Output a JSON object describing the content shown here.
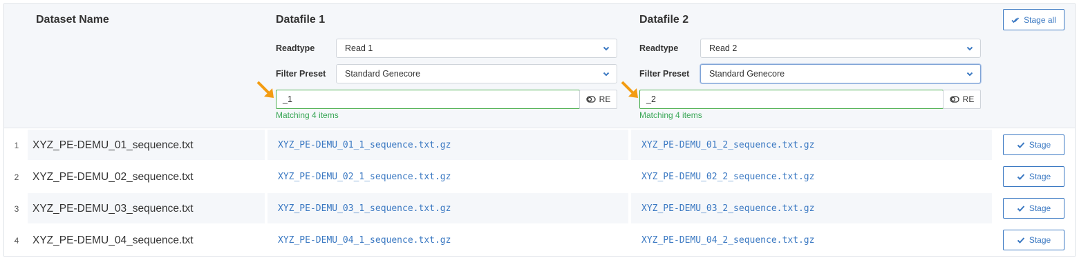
{
  "header": {
    "dataset_name_label": "Dataset Name",
    "datafile1_label": "Datafile 1",
    "datafile2_label": "Datafile 2",
    "stage_all_label": "Stage all"
  },
  "datafile1": {
    "readtype_label": "Readtype",
    "readtype_value": "Read 1",
    "filter_preset_label": "Filter Preset",
    "filter_preset_value": "Standard Genecore",
    "filter_value": "_1",
    "re_label": "RE",
    "match_text": "Matching 4 items"
  },
  "datafile2": {
    "readtype_label": "Readtype",
    "readtype_value": "Read 2",
    "filter_preset_label": "Filter Preset",
    "filter_preset_value": "Standard Genecore",
    "filter_value": "_2",
    "re_label": "RE",
    "match_text": "Matching 4 items"
  },
  "rows": [
    {
      "num": "1",
      "dataset": "XYZ_PE-DEMU_01_sequence.txt",
      "file1": "XYZ_PE-DEMU_01_1_sequence.txt.gz",
      "file2": "XYZ_PE-DEMU_01_2_sequence.txt.gz",
      "stage_label": "Stage"
    },
    {
      "num": "2",
      "dataset": "XYZ_PE-DEMU_02_sequence.txt",
      "file1": "XYZ_PE-DEMU_02_1_sequence.txt.gz",
      "file2": "XYZ_PE-DEMU_02_2_sequence.txt.gz",
      "stage_label": "Stage"
    },
    {
      "num": "3",
      "dataset": "XYZ_PE-DEMU_03_sequence.txt",
      "file1": "XYZ_PE-DEMU_03_1_sequence.txt.gz",
      "file2": "XYZ_PE-DEMU_03_2_sequence.txt.gz",
      "stage_label": "Stage"
    },
    {
      "num": "4",
      "dataset": "XYZ_PE-DEMU_04_sequence.txt",
      "file1": "XYZ_PE-DEMU_04_1_sequence.txt.gz",
      "file2": "XYZ_PE-DEMU_04_2_sequence.txt.gz",
      "stage_label": "Stage"
    }
  ],
  "colors": {
    "accent": "#3a78c2",
    "match_green": "#3aa757",
    "annotation_arrow": "#f39c12",
    "header_bg": "#f5f7fa"
  },
  "icons": {
    "stage_all": "double-check-icon",
    "stage": "check-icon",
    "re": "toggle-icon",
    "select": "chevron-down-icon",
    "annotation": "arrow-icon"
  }
}
